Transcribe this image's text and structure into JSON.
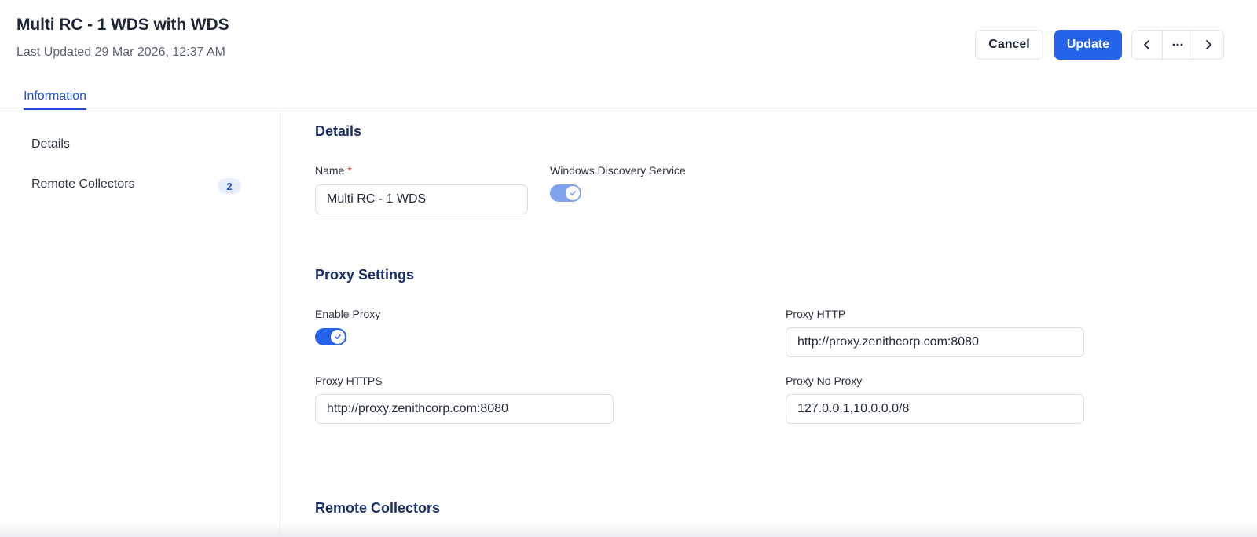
{
  "header": {
    "title": "Multi RC - 1 WDS with WDS",
    "subtitle": "Last Updated 29 Mar 2026, 12:37 AM",
    "cancel_label": "Cancel",
    "update_label": "Update",
    "more_label": "···"
  },
  "tabs": [
    {
      "label": "Information",
      "active": true
    }
  ],
  "sidebar": {
    "items": [
      {
        "label": "Details"
      },
      {
        "label": "Remote Collectors",
        "badge": "2"
      }
    ]
  },
  "details": {
    "title": "Details",
    "name_label": "Name",
    "name_required": "*",
    "name_value": "Multi RC - 1 WDS",
    "wds_label": "Windows Discovery Service",
    "wds_enabled": true
  },
  "proxy": {
    "title": "Proxy Settings",
    "enable_label": "Enable Proxy",
    "enable_on": true,
    "http_label": "Proxy HTTP",
    "http_value": "http://proxy.zenithcorp.com:8080",
    "https_label": "Proxy HTTPS",
    "https_value": "http://proxy.zenithcorp.com:8080",
    "noproxy_label": "Proxy No Proxy",
    "noproxy_value": "127.0.0.1,10.0.0.0/8"
  },
  "remote_collectors": {
    "title": "Remote Collectors"
  },
  "colors": {
    "accent": "#2563eb",
    "section_title": "#1b2f66",
    "required": "#dc2626"
  }
}
